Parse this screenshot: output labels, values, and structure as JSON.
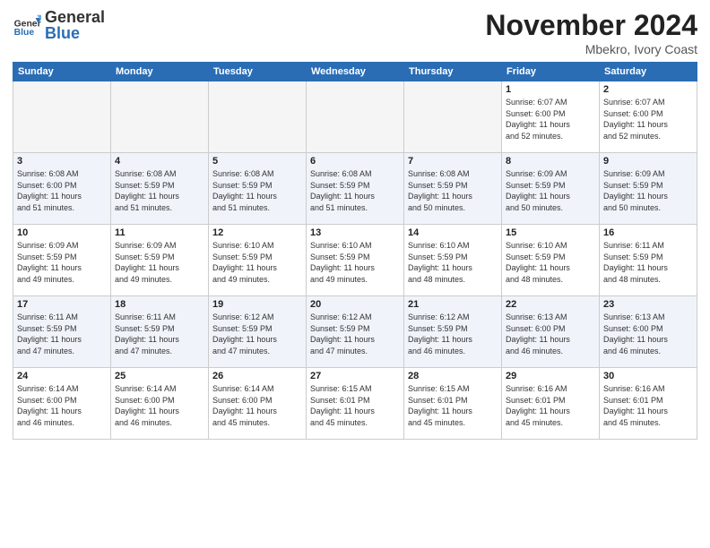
{
  "header": {
    "logo_general": "General",
    "logo_blue": "Blue",
    "month_title": "November 2024",
    "location": "Mbekro, Ivory Coast"
  },
  "weekdays": [
    "Sunday",
    "Monday",
    "Tuesday",
    "Wednesday",
    "Thursday",
    "Friday",
    "Saturday"
  ],
  "weeks": [
    [
      {
        "day": "",
        "info": ""
      },
      {
        "day": "",
        "info": ""
      },
      {
        "day": "",
        "info": ""
      },
      {
        "day": "",
        "info": ""
      },
      {
        "day": "",
        "info": ""
      },
      {
        "day": "1",
        "info": "Sunrise: 6:07 AM\nSunset: 6:00 PM\nDaylight: 11 hours\nand 52 minutes."
      },
      {
        "day": "2",
        "info": "Sunrise: 6:07 AM\nSunset: 6:00 PM\nDaylight: 11 hours\nand 52 minutes."
      }
    ],
    [
      {
        "day": "3",
        "info": "Sunrise: 6:08 AM\nSunset: 6:00 PM\nDaylight: 11 hours\nand 51 minutes."
      },
      {
        "day": "4",
        "info": "Sunrise: 6:08 AM\nSunset: 5:59 PM\nDaylight: 11 hours\nand 51 minutes."
      },
      {
        "day": "5",
        "info": "Sunrise: 6:08 AM\nSunset: 5:59 PM\nDaylight: 11 hours\nand 51 minutes."
      },
      {
        "day": "6",
        "info": "Sunrise: 6:08 AM\nSunset: 5:59 PM\nDaylight: 11 hours\nand 51 minutes."
      },
      {
        "day": "7",
        "info": "Sunrise: 6:08 AM\nSunset: 5:59 PM\nDaylight: 11 hours\nand 50 minutes."
      },
      {
        "day": "8",
        "info": "Sunrise: 6:09 AM\nSunset: 5:59 PM\nDaylight: 11 hours\nand 50 minutes."
      },
      {
        "day": "9",
        "info": "Sunrise: 6:09 AM\nSunset: 5:59 PM\nDaylight: 11 hours\nand 50 minutes."
      }
    ],
    [
      {
        "day": "10",
        "info": "Sunrise: 6:09 AM\nSunset: 5:59 PM\nDaylight: 11 hours\nand 49 minutes."
      },
      {
        "day": "11",
        "info": "Sunrise: 6:09 AM\nSunset: 5:59 PM\nDaylight: 11 hours\nand 49 minutes."
      },
      {
        "day": "12",
        "info": "Sunrise: 6:10 AM\nSunset: 5:59 PM\nDaylight: 11 hours\nand 49 minutes."
      },
      {
        "day": "13",
        "info": "Sunrise: 6:10 AM\nSunset: 5:59 PM\nDaylight: 11 hours\nand 49 minutes."
      },
      {
        "day": "14",
        "info": "Sunrise: 6:10 AM\nSunset: 5:59 PM\nDaylight: 11 hours\nand 48 minutes."
      },
      {
        "day": "15",
        "info": "Sunrise: 6:10 AM\nSunset: 5:59 PM\nDaylight: 11 hours\nand 48 minutes."
      },
      {
        "day": "16",
        "info": "Sunrise: 6:11 AM\nSunset: 5:59 PM\nDaylight: 11 hours\nand 48 minutes."
      }
    ],
    [
      {
        "day": "17",
        "info": "Sunrise: 6:11 AM\nSunset: 5:59 PM\nDaylight: 11 hours\nand 47 minutes."
      },
      {
        "day": "18",
        "info": "Sunrise: 6:11 AM\nSunset: 5:59 PM\nDaylight: 11 hours\nand 47 minutes."
      },
      {
        "day": "19",
        "info": "Sunrise: 6:12 AM\nSunset: 5:59 PM\nDaylight: 11 hours\nand 47 minutes."
      },
      {
        "day": "20",
        "info": "Sunrise: 6:12 AM\nSunset: 5:59 PM\nDaylight: 11 hours\nand 47 minutes."
      },
      {
        "day": "21",
        "info": "Sunrise: 6:12 AM\nSunset: 5:59 PM\nDaylight: 11 hours\nand 46 minutes."
      },
      {
        "day": "22",
        "info": "Sunrise: 6:13 AM\nSunset: 6:00 PM\nDaylight: 11 hours\nand 46 minutes."
      },
      {
        "day": "23",
        "info": "Sunrise: 6:13 AM\nSunset: 6:00 PM\nDaylight: 11 hours\nand 46 minutes."
      }
    ],
    [
      {
        "day": "24",
        "info": "Sunrise: 6:14 AM\nSunset: 6:00 PM\nDaylight: 11 hours\nand 46 minutes."
      },
      {
        "day": "25",
        "info": "Sunrise: 6:14 AM\nSunset: 6:00 PM\nDaylight: 11 hours\nand 46 minutes."
      },
      {
        "day": "26",
        "info": "Sunrise: 6:14 AM\nSunset: 6:00 PM\nDaylight: 11 hours\nand 45 minutes."
      },
      {
        "day": "27",
        "info": "Sunrise: 6:15 AM\nSunset: 6:01 PM\nDaylight: 11 hours\nand 45 minutes."
      },
      {
        "day": "28",
        "info": "Sunrise: 6:15 AM\nSunset: 6:01 PM\nDaylight: 11 hours\nand 45 minutes."
      },
      {
        "day": "29",
        "info": "Sunrise: 6:16 AM\nSunset: 6:01 PM\nDaylight: 11 hours\nand 45 minutes."
      },
      {
        "day": "30",
        "info": "Sunrise: 6:16 AM\nSunset: 6:01 PM\nDaylight: 11 hours\nand 45 minutes."
      }
    ]
  ]
}
